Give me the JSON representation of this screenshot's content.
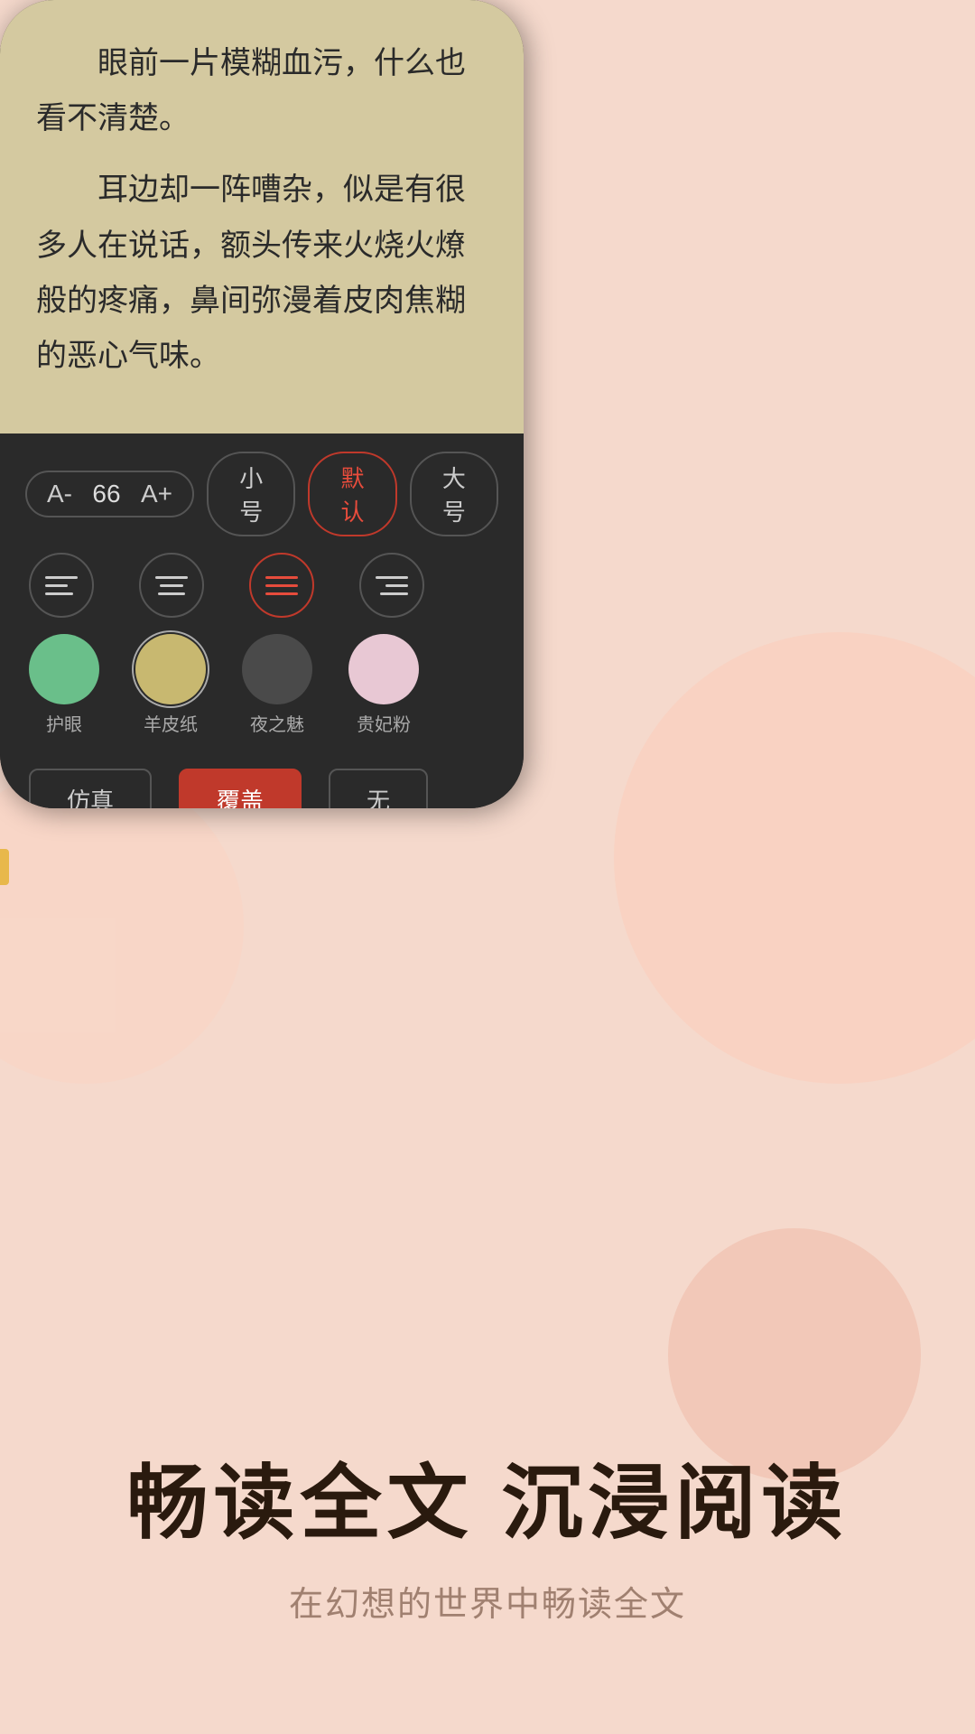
{
  "reading": {
    "text_line1": "眼前一片模糊血污，什么也",
    "text_line2": "看不清楚。",
    "text_line3": "耳边却一阵嘈杂，似是有很",
    "text_line4": "多人在说话，额头传来火烧火燎",
    "text_line5": "般的疼痛，鼻间弥漫着皮肉焦糊",
    "text_line6": "的恶心气味。"
  },
  "font_controls": {
    "decrease_label": "A-",
    "size_value": "66",
    "increase_label": "A+",
    "small_label": "小号",
    "default_label": "默认",
    "large_label": "大号"
  },
  "themes": [
    {
      "id": "eye",
      "label": "护眼",
      "color": "#6abf8a"
    },
    {
      "id": "parchment",
      "label": "羊皮纸",
      "color": "#c8b870"
    },
    {
      "id": "night",
      "label": "夜之魅",
      "color": "#4a4a4a"
    },
    {
      "id": "pink",
      "label": "贵妃粉",
      "color": "#e8c8d4"
    }
  ],
  "modes": [
    {
      "id": "realistic",
      "label": "仿真"
    },
    {
      "id": "cover",
      "label": "覆盖",
      "active": true
    },
    {
      "id": "none",
      "label": "无"
    }
  ],
  "bottom": {
    "main_title": "畅读全文  沉浸阅读",
    "sub_title": "在幻想的世界中畅读全文"
  }
}
